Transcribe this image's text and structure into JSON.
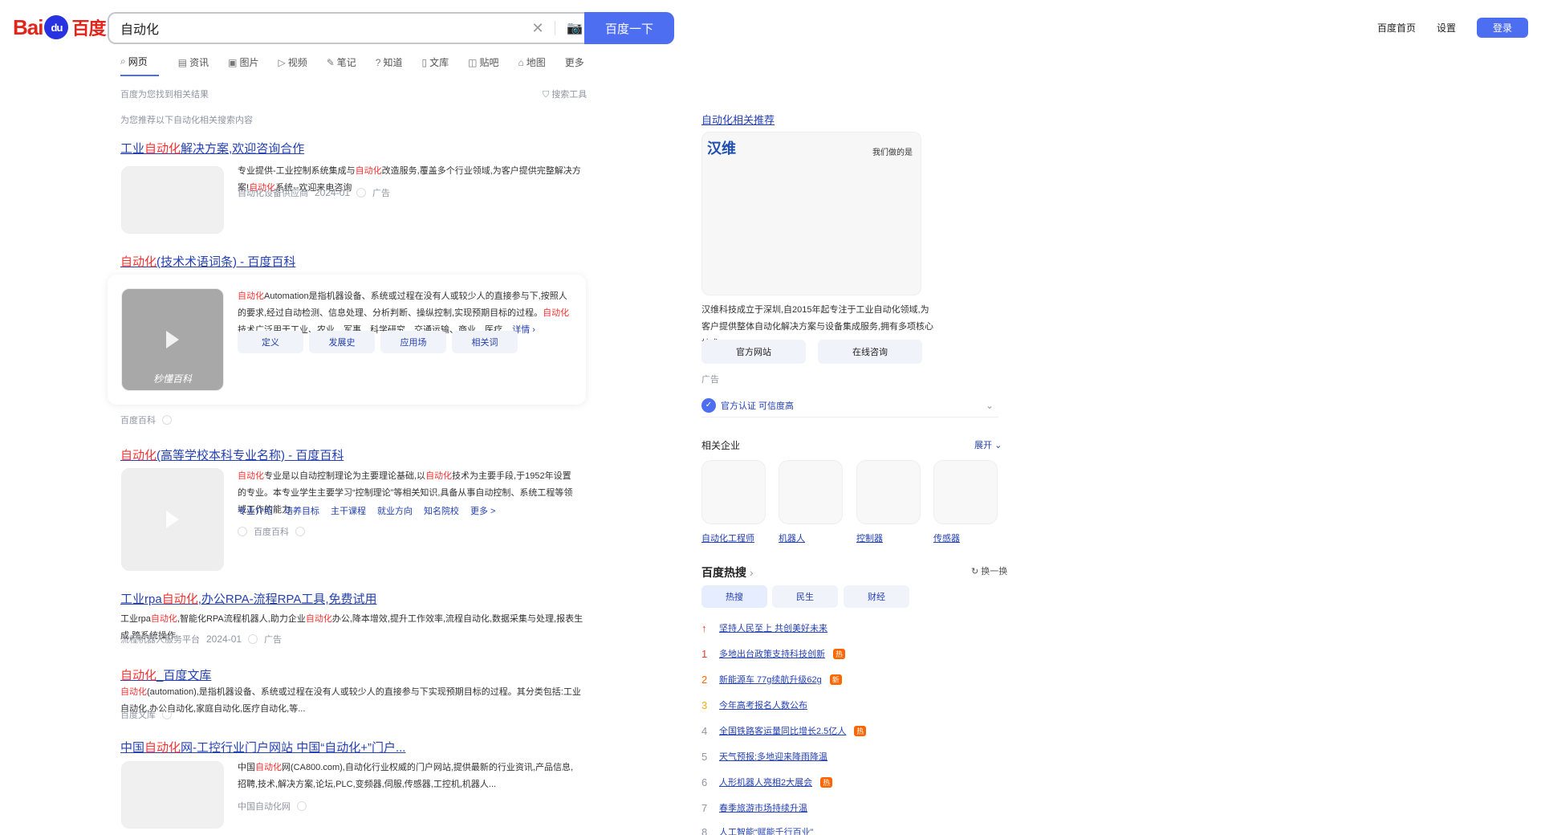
{
  "logo": {
    "bai": "Bai",
    "du": "du",
    "cn": "百度"
  },
  "search": {
    "query": "自动化",
    "button": "百度一下"
  },
  "topright": {
    "link1": "百度首页",
    "link2": "设置",
    "login": "登录"
  },
  "tabs": [
    "网页",
    "资讯",
    "图片",
    "视频",
    "笔记",
    "知道",
    "文库",
    "贴吧",
    "地图",
    "更多"
  ],
  "meta": {
    "results": "百度为您找到相关结果",
    "tools": "搜索工具",
    "tip": "为您推荐以下自动化相关搜索内容"
  },
  "results": [
    {
      "title_pre": "工业",
      "title_em": "自动化",
      "title_post": "解决方案,欢迎咨询合作",
      "abstract_pre": "专业提供-工业控制系统集成与",
      "abstract_em": "自动化",
      "abstract_post": "改造服务,覆盖多个行业领域,为客户提供完整解决方案!",
      "abstract_em2": "自动化",
      "abstract_post2": "系统--欢迎来电咨询",
      "source": "自动化设备供应商",
      "date": "2024-01",
      "tag": "广告"
    },
    {
      "title_em": "自动化",
      "title_post": "(技术术语词条) - 百度百科",
      "abstract_pre": "",
      "abstract_em": "自动化",
      "abstract_post": "Automation是指机器设备、系统或过程在没有人或较少人的直接参与下,按照人的要求,经过自动检测、信息处理、分析判断、操纵控制,实现预期目标的过程。",
      "abstract_em2": "自动化",
      "abstract_post2": "技术广泛用于工业、农业、军事、科学研究、交通运输、商业、医疗...",
      "more": "详情",
      "pills": [
        "定义",
        "发展史",
        "应用场",
        "相关词"
      ],
      "source": "百度百科",
      "wm": "秒懂百科"
    },
    {
      "title_em": "自动化",
      "title_post": "(高等学校本科专业名称) - 百度百科",
      "abstract_pre": "",
      "abstract_em": "自动化",
      "abstract_post": "专业是以自动控制理论为主要理论基础,以",
      "abstract_em2": "自动化",
      "abstract_post2": "技术为主要手段,于1952年设置的专业。本专业学生主要学习“控制理论”等相关知识,具备从事自动控制、系统工程等领域工作的能力...",
      "links": [
        "专业介绍",
        "培养目标",
        "主干课程",
        "就业方向",
        "知名院校",
        "更多 >"
      ],
      "source": "百度百科"
    },
    {
      "title_pre": "工业rpa",
      "title_em": "自动化",
      "title_post": ",办公RPA-流程RPA工具,免费试用",
      "abstract_pre": "工业rpa",
      "abstract_em": "自动化",
      "abstract_post": ",智能化RPA流程机器人,助力企业",
      "abstract_em2": "自动化",
      "abstract_post2": "办公,降本增效,提升工作效率,流程自动化,数据采集与处理,报表生成,跨系统操作",
      "source": "流程机器人服务平台",
      "date": "2024-01",
      "tag": "广告"
    },
    {
      "title_em": "自动化",
      "title_post": "_百度文库",
      "abstract_pre": "",
      "abstract_em": "自动化",
      "abstract_post": "(automation),是指机器设备、系统或过程在没有人或较少人的直接参与下实现预期目标的过程。其分类包括:工业自动化,办公自动化,家庭自动化,医疗自动化,等...",
      "source": "百度文库"
    },
    {
      "title_pre": "中国",
      "title_em": "自动化",
      "title_post": "网-工控行业门户网站 中国“自动化+”门户...",
      "abstract_pre": "中国",
      "abstract_em": "自动化",
      "abstract_post": "网(CA800.com),自动化行业权威的门户网站,提供最新的行业资讯,产品信息,招聘,技术,解决方案,论坛,PLC,变频器,伺服,传感器,工控机,机器人...",
      "source": "中国自动化网"
    }
  ],
  "right": {
    "title": "自动化相关推荐",
    "brand": "汉维",
    "slogan": "我们做的是",
    "desc": "汉维科技成立于深圳,自2015年起专注于工业自动化领域,为客户提供整体自动化解决方案与设备集成服务,拥有多项核心技术...",
    "btn1": "官方网站",
    "btn2": "在线咨询",
    "ad": "广告",
    "verify": "官方认证 可信度高",
    "ent_title": "相关企业",
    "ent_more": "展开",
    "entities": [
      "自动化工程师",
      "机器人",
      "控制器",
      "传感器"
    ],
    "hot_title": "百度热搜",
    "hot_refresh": "换一换",
    "hot_tabs": [
      "热搜",
      "民生",
      "财经"
    ],
    "hot_top": "坚持人民至上 共创美好未来",
    "hot": [
      {
        "n": "1",
        "t": "多地出台政策支持科技创新",
        "b": "热"
      },
      {
        "n": "2",
        "t": "新能源车 77g续航升级62g",
        "b": "新"
      },
      {
        "n": "3",
        "t": "今年高考报名人数公布",
        "b": ""
      },
      {
        "n": "4",
        "t": "全国铁路客运量同比增长2.5亿人",
        "b": "热"
      },
      {
        "n": "5",
        "t": "天气预报:多地迎来降雨降温",
        "b": ""
      },
      {
        "n": "6",
        "t": "人形机器人亮相2大展会",
        "b": "热"
      },
      {
        "n": "7",
        "t": "春季旅游市场持续升温",
        "b": ""
      },
      {
        "n": "8",
        "t": "人工智能“赋能千行百业”",
        "b": ""
      }
    ]
  },
  "colors": {
    "accent": "#4e6ef2",
    "link": "#2440b3",
    "highlight": "#f73131",
    "hot_badge": "#ff6600"
  }
}
